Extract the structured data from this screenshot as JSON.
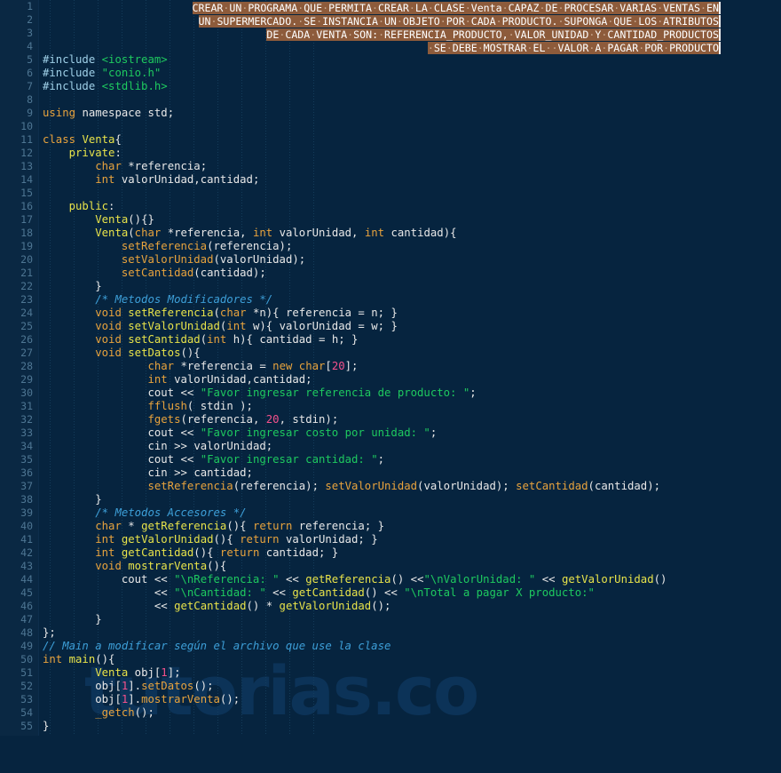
{
  "editor": {
    "name": "code-editor",
    "language": "C++",
    "theme_background": "#06243f",
    "gutter_background": "#0a2843",
    "selection_background": "#8d5b3b",
    "total_lines": 55,
    "first_visible_line": 1,
    "last_visible_line": 55
  },
  "watermark": {
    "text": "tutorias.co",
    "color": "#0c3358"
  },
  "gutter": {
    "line_numbers": [
      "1",
      "2",
      "3",
      "4",
      "5",
      "6",
      "7",
      "8",
      "9",
      "10",
      "11",
      "12",
      "13",
      "14",
      "15",
      "16",
      "17",
      "18",
      "19",
      "20",
      "21",
      "22",
      "23",
      "24",
      "25",
      "26",
      "27",
      "28",
      "29",
      "30",
      "31",
      "32",
      "33",
      "34",
      "35",
      "36",
      "37",
      "38",
      "39",
      "40",
      "41",
      "42",
      "43",
      "44",
      "45",
      "46",
      "47",
      "48",
      "49",
      "50",
      "51",
      "52",
      "53",
      "54",
      "55"
    ]
  },
  "selection": {
    "is_selected": true,
    "space_marker": "·",
    "caret_color": "#eeeeee",
    "lines": [
      "CREAR·UN·PROGRAMA·QUE·PERMITA·CREAR·LA·CLASE·Venta·CAPAZ·DE·PROCESAR·VARIAS·VENTAS·EN",
      "UN·SUPERMERCADO.·SE·INSTANCIA·UN·OBJETO·POR·CADA·PRODUCTO.·SUPONGA·QUE·LOS·ATRIBUTOS",
      "DE·CADA·VENTA·SON:·REFERENCIA_PRODUCTO,·VALOR_UNIDAD·Y·CANTIDAD_PRODUCTOS",
      "·SE·DEBE·MOSTRAR·EL··VALOR·A·PAGAR·POR·PRODUCTO"
    ]
  },
  "code": {
    "lines": [
      {
        "n": 1,
        "text": ""
      },
      {
        "n": 2,
        "text": ""
      },
      {
        "n": 3,
        "text": ""
      },
      {
        "n": 4,
        "text": ""
      },
      {
        "n": 5,
        "text": "#include <iostream>"
      },
      {
        "n": 6,
        "text": "#include \"conio.h\""
      },
      {
        "n": 7,
        "text": "#include <stdlib.h>"
      },
      {
        "n": 8,
        "text": ""
      },
      {
        "n": 9,
        "text": "using namespace std;"
      },
      {
        "n": 10,
        "text": ""
      },
      {
        "n": 11,
        "text": "class Venta{"
      },
      {
        "n": 12,
        "text": "    private:"
      },
      {
        "n": 13,
        "text": "        char *referencia;"
      },
      {
        "n": 14,
        "text": "        int valorUnidad,cantidad;"
      },
      {
        "n": 15,
        "text": ""
      },
      {
        "n": 16,
        "text": "    public:"
      },
      {
        "n": 17,
        "text": "        Venta(){}"
      },
      {
        "n": 18,
        "text": "        Venta(char *referencia, int valorUnidad, int cantidad){"
      },
      {
        "n": 19,
        "text": "            setReferencia(referencia);"
      },
      {
        "n": 20,
        "text": "            setValorUnidad(valorUnidad);"
      },
      {
        "n": 21,
        "text": "            setCantidad(cantidad);"
      },
      {
        "n": 22,
        "text": "        }"
      },
      {
        "n": 23,
        "text": "        /* Metodos Modificadores */"
      },
      {
        "n": 24,
        "text": "        void setReferencia(char *n){ referencia = n; }"
      },
      {
        "n": 25,
        "text": "        void setValorUnidad(int w){ valorUnidad = w; }"
      },
      {
        "n": 26,
        "text": "        void setCantidad(int h){ cantidad = h; }"
      },
      {
        "n": 27,
        "text": "        void setDatos(){"
      },
      {
        "n": 28,
        "text": "                char *referencia = new char[20];"
      },
      {
        "n": 29,
        "text": "                int valorUnidad,cantidad;"
      },
      {
        "n": 30,
        "text": "                cout << \"Favor ingresar referencia de producto: \";"
      },
      {
        "n": 31,
        "text": "                fflush( stdin );"
      },
      {
        "n": 32,
        "text": "                fgets(referencia, 20, stdin);"
      },
      {
        "n": 33,
        "text": "                cout << \"Favor ingresar costo por unidad: \";"
      },
      {
        "n": 34,
        "text": "                cin >> valorUnidad;"
      },
      {
        "n": 35,
        "text": "                cout << \"Favor ingresar cantidad: \";"
      },
      {
        "n": 36,
        "text": "                cin >> cantidad;"
      },
      {
        "n": 37,
        "text": "                setReferencia(referencia); setValorUnidad(valorUnidad); setCantidad(cantidad);"
      },
      {
        "n": 38,
        "text": "        }"
      },
      {
        "n": 39,
        "text": "        /* Metodos Accesores */"
      },
      {
        "n": 40,
        "text": "        char * getReferencia(){ return referencia; }"
      },
      {
        "n": 41,
        "text": "        int getValorUnidad(){ return valorUnidad; }"
      },
      {
        "n": 42,
        "text": "        int getCantidad(){ return cantidad; }"
      },
      {
        "n": 43,
        "text": "        void mostrarVenta(){"
      },
      {
        "n": 44,
        "text": "            cout << \"\\nReferencia: \" << getReferencia() <<\"\\nValorUnidad: \" << getValorUnidad()"
      },
      {
        "n": 45,
        "text": "                 << \"\\nCantidad: \" << getCantidad() << \"\\nTotal a pagar X producto:\""
      },
      {
        "n": 46,
        "text": "                 << getCantidad() * getValorUnidad();"
      },
      {
        "n": 47,
        "text": "        }"
      },
      {
        "n": 48,
        "text": "};"
      },
      {
        "n": 49,
        "text": "// Main a modificar según el archivo que use la clase"
      },
      {
        "n": 50,
        "text": "int main(){"
      },
      {
        "n": 51,
        "text": "        Venta obj[1];"
      },
      {
        "n": 52,
        "text": "        obj[1].setDatos();"
      },
      {
        "n": 53,
        "text": "        obj[1].mostrarVenta();"
      },
      {
        "n": 54,
        "text": "        _getch();"
      },
      {
        "n": 55,
        "text": "}"
      }
    ],
    "html": [
      "",
      "",
      "",
      "",
      "<span class='pre'>#include</span> <span class='str'>&lt;iostream&gt;</span>",
      "<span class='pre'>#include</span> <span class='str'>\"conio.h\"</span>",
      "<span class='pre'>#include</span> <span class='str'>&lt;stdlib.h&gt;</span>",
      "",
      "<span class='kw'>using</span> <span class='id'>namespace</span> <span class='id'>std</span>;",
      "",
      "<span class='kw'>class</span> <span class='fn'>Venta</span>{",
      "    <span class='fn'>private</span>:",
      "        <span class='kw'>char</span> *<span class='id'>referencia</span>;",
      "        <span class='kw'>int</span> <span class='id'>valorUnidad</span>,<span class='id'>cantidad</span>;",
      "",
      "    <span class='fn'>public</span>:",
      "        <span class='fn'>Venta</span>(){}",
      "        <span class='fn'>Venta</span>(<span class='kw'>char</span> *<span class='id'>referencia</span>, <span class='kw'>int</span> <span class='id'>valorUnidad</span>, <span class='kw'>int</span> <span class='id'>cantidad</span>){",
      "            <span class='call'>setReferencia</span>(<span class='id'>referencia</span>);",
      "            <span class='call'>setValorUnidad</span>(<span class='id'>valorUnidad</span>);",
      "            <span class='call'>setCantidad</span>(<span class='id'>cantidad</span>);",
      "        }",
      "        <span class='cmt'>/* Metodos Modificadores */</span>",
      "        <span class='kw'>void</span> <span class='fn'>setReferencia</span>(<span class='kw'>char</span> *<span class='id'>n</span>){ <span class='id'>referencia</span> = <span class='id'>n</span>; }",
      "        <span class='kw'>void</span> <span class='fn'>setValorUnidad</span>(<span class='kw'>int</span> <span class='id'>w</span>){ <span class='id'>valorUnidad</span> = <span class='id'>w</span>; }",
      "        <span class='kw'>void</span> <span class='fn'>setCantidad</span>(<span class='kw'>int</span> <span class='id'>h</span>){ <span class='id'>cantidad</span> = <span class='id'>h</span>; }",
      "        <span class='kw'>void</span> <span class='fn'>setDatos</span>(){",
      "                <span class='kw'>char</span> *<span class='id'>referencia</span> = <span class='kw'>new</span> <span class='kw'>char</span>[<span class='num'>20</span>];",
      "                <span class='kw'>int</span> <span class='id'>valorUnidad</span>,<span class='id'>cantidad</span>;",
      "                <span class='id'>cout</span> &lt;&lt; <span class='str'>\"Favor ingresar referencia de producto: \"</span>;",
      "                <span class='call'>fflush</span>( <span class='id'>stdin</span> );",
      "                <span class='call'>fgets</span>(<span class='id'>referencia</span>, <span class='num'>20</span>, <span class='id'>stdin</span>);",
      "                <span class='id'>cout</span> &lt;&lt; <span class='str'>\"Favor ingresar costo por unidad: \"</span>;",
      "                <span class='id'>cin</span> &gt;&gt; <span class='id'>valorUnidad</span>;",
      "                <span class='id'>cout</span> &lt;&lt; <span class='str'>\"Favor ingresar cantidad: \"</span>;",
      "                <span class='id'>cin</span> &gt;&gt; <span class='id'>cantidad</span>;",
      "                <span class='call'>setReferencia</span>(<span class='id'>referencia</span>); <span class='call'>setValorUnidad</span>(<span class='id'>valorUnidad</span>); <span class='call'>setCantidad</span>(<span class='id'>cantidad</span>);",
      "        }",
      "        <span class='cmt'>/* Metodos Accesores */</span>",
      "        <span class='kw'>char</span> * <span class='fn'>getReferencia</span>(){ <span class='kw'>return</span> <span class='id'>referencia</span>; }",
      "        <span class='kw'>int</span> <span class='fn'>getValorUnidad</span>(){ <span class='kw'>return</span> <span class='id'>valorUnidad</span>; }",
      "        <span class='kw'>int</span> <span class='fn'>getCantidad</span>(){ <span class='kw'>return</span> <span class='id'>cantidad</span>; }",
      "        <span class='kw'>void</span> <span class='fn'>mostrarVenta</span>(){",
      "            <span class='id'>cout</span> &lt;&lt; <span class='str'>\"\\nReferencia: \"</span> &lt;&lt; <span class='fn'>getReferencia</span>() &lt;&lt;<span class='str'>\"\\nValorUnidad: \"</span> &lt;&lt; <span class='fn'>getValorUnidad</span>()",
      "                 &lt;&lt; <span class='str'>\"\\nCantidad: \"</span> &lt;&lt; <span class='fn'>getCantidad</span>() &lt;&lt; <span class='str'>\"\\nTotal a pagar X producto:\"</span>",
      "                 &lt;&lt; <span class='fn'>getCantidad</span>() * <span class='fn'>getValorUnidad</span>();",
      "        }",
      "};",
      "<span class='cmt'>// Main a modificar según el archivo que use la clase</span>",
      "<span class='kw'>int</span> <span class='fn'>main</span>(){",
      "        <span class='fn'>Venta</span> <span class='id'>obj</span>[<span class='num'>1</span>];",
      "        <span class='id'>obj</span>[<span class='num'>1</span>].<span class='call'>setDatos</span>();",
      "        <span class='id'>obj</span>[<span class='num'>1</span>].<span class='call'>mostrarVenta</span>();",
      "        <span class='call'>_getch</span>();",
      "}"
    ]
  },
  "indent_guides": {
    "visible": true,
    "color": "#16405f",
    "x_positions": [
      13,
      40,
      67,
      94,
      121,
      148,
      175,
      202,
      229,
      256,
      283,
      310
    ]
  }
}
